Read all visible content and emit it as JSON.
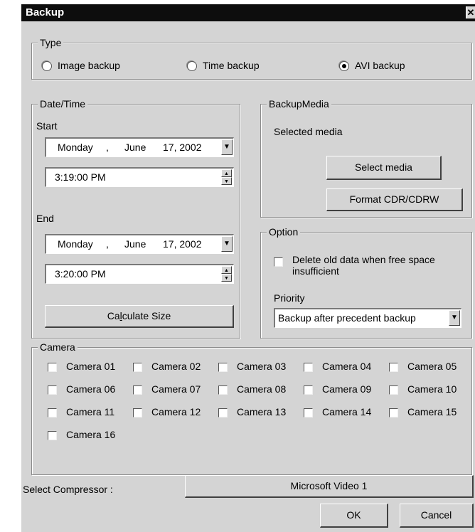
{
  "window": {
    "title": "Backup",
    "close_glyph": "✕"
  },
  "type_group": {
    "label": "Type",
    "options": [
      "Image backup",
      "Time backup",
      "AVI backup"
    ],
    "selected_index": 2
  },
  "datetime_group": {
    "label": "Date/Time",
    "start_label": "Start",
    "start_date": {
      "weekday": "Monday",
      "sep": ",",
      "month": "June",
      "daynum": "17, 2002"
    },
    "start_time": "3:19:00 PM",
    "end_label": "End",
    "end_date": {
      "weekday": "Monday",
      "sep": ",",
      "month": "June",
      "daynum": "17, 2002"
    },
    "end_time": "3:20:00 PM",
    "calc_button": {
      "pre": "Ca",
      "hot": "l",
      "post": "culate Size"
    }
  },
  "media_group": {
    "label": "BackupMedia",
    "selected_text": "Selected media",
    "select_button": "Select media",
    "format_button": "Format CDR/CDRW"
  },
  "option_group": {
    "label": "Option",
    "delete_label_line1": "Delete old data when free space",
    "delete_label_line2": "insufficient",
    "priority_label": "Priority",
    "priority_value": "Backup after precedent backup"
  },
  "camera_group": {
    "label": "Camera",
    "cameras": [
      "Camera 01",
      "Camera 02",
      "Camera 03",
      "Camera 04",
      "Camera 05",
      "Camera 06",
      "Camera 07",
      "Camera 08",
      "Camera 09",
      "Camera 10",
      "Camera 11",
      "Camera 12",
      "Camera 13",
      "Camera 14",
      "Camera 15",
      "Camera 16"
    ]
  },
  "compressor": {
    "label": "Select Compressor :",
    "value": "Microsoft Video 1"
  },
  "footer": {
    "ok": "OK",
    "cancel": "Cancel"
  },
  "icons": {
    "dropdown": "triangle-down",
    "spin_up": "triangle-up",
    "spin_down": "triangle-down"
  }
}
